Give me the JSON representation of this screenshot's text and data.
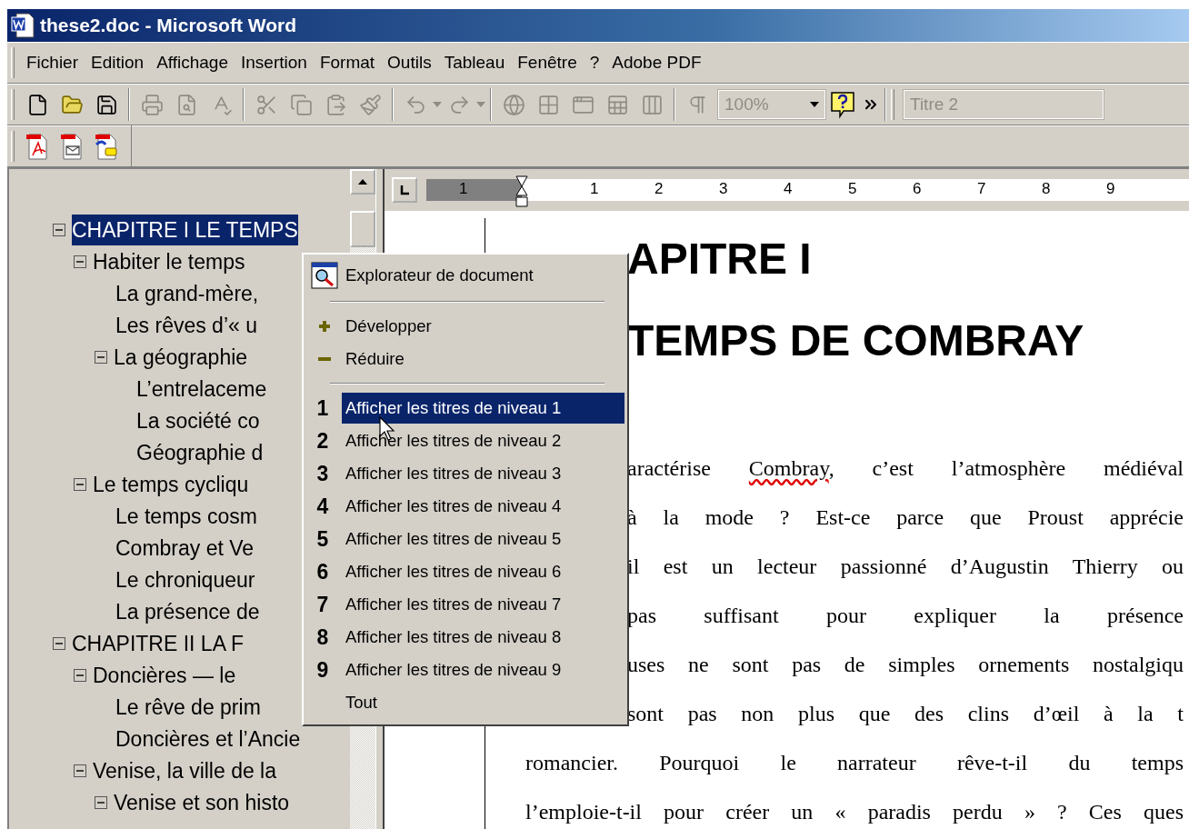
{
  "window": {
    "title": "these2.doc - Microsoft Word"
  },
  "menu_bar": [
    "Fichier",
    "Edition",
    "Affichage",
    "Insertion",
    "Format",
    "Outils",
    "Tableau",
    "Fenêtre",
    "?",
    "Adobe PDF"
  ],
  "toolbar": {
    "buttons": [
      {
        "disabled": false
      },
      {
        "disabled": false
      },
      {
        "disabled": false
      },
      {
        "disabled": true
      },
      {
        "disabled": true
      },
      {
        "disabled": true
      },
      {
        "disabled": true
      },
      {
        "disabled": true
      },
      {
        "disabled": true
      },
      {
        "disabled": true
      },
      {
        "disabled": true
      },
      {
        "disabled": true
      },
      {
        "disabled": true
      },
      {
        "disabled": true
      },
      {
        "disabled": true
      },
      {
        "disabled": true
      },
      {
        "disabled": true
      },
      {
        "disabled": true
      }
    ],
    "zoom": {
      "value": "100%",
      "disabled": true
    },
    "style": {
      "value": "Titre 2",
      "disabled": true
    }
  },
  "pdf_toolbar": {
    "buttons": [
      {
        "disabled": false
      },
      {
        "disabled": false
      },
      {
        "disabled": false
      }
    ]
  },
  "document_map": {
    "tree": [
      {
        "label": "CHAPITRE I LE TEMPS",
        "selected": true,
        "expanded": true,
        "children": [
          {
            "label": "Habiter le temps",
            "selected": false,
            "expanded": true,
            "children": [
              {
                "label": "La grand-mère,",
                "selected": false
              },
              {
                "label": "Les rêves d’« u",
                "selected": false
              },
              {
                "label": "La géographie",
                "selected": false,
                "expanded": true,
                "children": [
                  {
                    "label": "L’entrelaceme",
                    "selected": false
                  },
                  {
                    "label": "La société co",
                    "selected": false
                  },
                  {
                    "label": "Géographie d",
                    "selected": false
                  }
                ]
              }
            ]
          },
          {
            "label": "Le temps cycliqu",
            "selected": false,
            "expanded": true,
            "children": [
              {
                "label": "Le temps cosm",
                "selected": false
              },
              {
                "label": "Combray et Ve",
                "selected": false
              },
              {
                "label": "Le chroniqueur",
                "selected": false
              },
              {
                "label": "La présence de",
                "selected": false
              }
            ]
          }
        ]
      },
      {
        "label": "CHAPITRE II LA F",
        "selected": false,
        "expanded": true,
        "children": [
          {
            "label": "Doncières — le",
            "selected": false,
            "expanded": true,
            "children": [
              {
                "label": "Le rêve de prim",
                "selected": false
              },
              {
                "label": "Doncières et l’Ancie",
                "selected": false
              }
            ]
          },
          {
            "label": "Venise, la ville de la",
            "selected": false,
            "expanded": true,
            "children": [
              {
                "label": "Venise et son histo",
                "selected": false,
                "expanded": true
              }
            ]
          }
        ]
      }
    ]
  },
  "ruler": {
    "labels": [
      "1",
      "1",
      "2",
      "3",
      "4",
      "5",
      "6",
      "7",
      "8",
      "9"
    ]
  },
  "document": {
    "headings": [
      {
        "text": "APITRE I",
        "kind": "covered"
      },
      {
        "text": "TEMPS DE COMBRAY",
        "kind": "covered"
      }
    ],
    "lines": [
      {
        "kind": "covered",
        "segments": [
          {
            "text": "aractérise ",
            "misspelled": false
          },
          {
            "text": "Combray",
            "misspelled": true
          },
          {
            "text": ", c’est l’atmosphère médiéval",
            "misspelled": false
          }
        ]
      },
      {
        "kind": "covered",
        "segments": [
          {
            "text": "à la mode ? Est-ce parce que Proust apprécie",
            "misspelled": false
          }
        ]
      },
      {
        "kind": "covered",
        "segments": [
          {
            "text": "il est un lecteur passionné d’Augustin Thierry ou",
            "misspelled": false
          }
        ]
      },
      {
        "kind": "covered",
        "segments": [
          {
            "text": "pas suffisant pour expliquer la présence",
            "misspelled": false
          }
        ]
      },
      {
        "kind": "covered",
        "segments": [
          {
            "text": "uses ne sont pas de simples ornements nostalgiqu",
            "misspelled": false
          }
        ]
      },
      {
        "kind": "covered",
        "segments": [
          {
            "text": "sont pas non plus que des clins d’œil à la t",
            "misspelled": false
          }
        ]
      },
      {
        "kind": "full",
        "segments": [
          {
            "text": "romancier. Pourquoi le narrateur rêve-t-il du temps",
            "misspelled": false
          }
        ]
      },
      {
        "kind": "full",
        "segments": [
          {
            "text": "l’emploie-t-il pour créer un « paradis perdu » ? Ces ques",
            "misspelled": false
          }
        ]
      }
    ]
  },
  "context_menu": {
    "items": [
      {
        "kind": "header",
        "label": "Explorateur de document",
        "selected": false
      },
      {
        "kind": "separator"
      },
      {
        "kind": "expand",
        "label": "Développer",
        "selected": false
      },
      {
        "kind": "collapse",
        "label": "Réduire",
        "selected": false
      },
      {
        "kind": "separator"
      },
      {
        "kind": "level",
        "number": "1",
        "label": "Afficher les titres de niveau 1",
        "selected": true
      },
      {
        "kind": "level",
        "number": "2",
        "label": "Afficher les titres de niveau 2",
        "selected": false
      },
      {
        "kind": "level",
        "number": "3",
        "label": "Afficher les titres de niveau 3",
        "selected": false
      },
      {
        "kind": "level",
        "number": "4",
        "label": "Afficher les titres de niveau 4",
        "selected": false
      },
      {
        "kind": "level",
        "number": "5",
        "label": "Afficher les titres de niveau 5",
        "selected": false
      },
      {
        "kind": "level",
        "number": "6",
        "label": "Afficher les titres de niveau 6",
        "selected": false
      },
      {
        "kind": "level",
        "number": "7",
        "label": "Afficher les titres de niveau 7",
        "selected": false
      },
      {
        "kind": "level",
        "number": "8",
        "label": "Afficher les titres de niveau 8",
        "selected": false
      },
      {
        "kind": "level",
        "number": "9",
        "label": "Afficher les titres de niveau 9",
        "selected": false
      },
      {
        "kind": "all",
        "label": "Tout",
        "selected": false
      }
    ]
  }
}
